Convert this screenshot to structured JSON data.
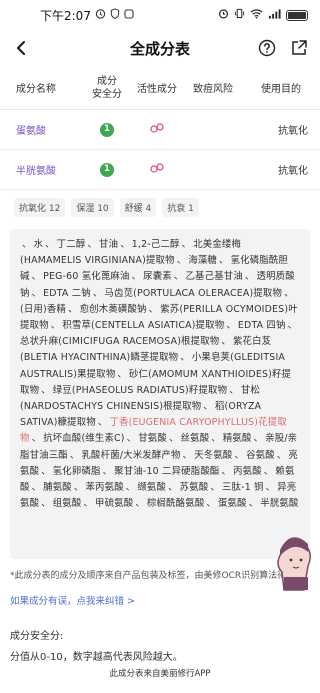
{
  "status": {
    "time": "下午2:07",
    "battery": "100"
  },
  "nav": {
    "title": "全成分表"
  },
  "table": {
    "headers": {
      "name": "成分名称",
      "safety_line1": "成分",
      "safety_line2": "安全分",
      "active": "活性成分",
      "acne": "致痘风险",
      "use": "使用目的"
    },
    "rows": [
      {
        "name": "蛋氨酸",
        "safety": "1",
        "use": "抗氧化"
      },
      {
        "name": "半胱氨酸",
        "safety": "1",
        "use": "抗氧化"
      }
    ]
  },
  "tags": [
    "抗氧化 12",
    "保湿 10",
    "舒缓 4",
    "抗衰 1"
  ],
  "ingredients": [
    "水",
    "丁二醇",
    "甘油",
    "1,2-己二醇",
    "北美金缕梅(HAMAMELIS VIRGINIANA)提取物",
    "海藻糖",
    "氢化磷脂酰胆碱",
    "PEG-60 氢化蓖麻油",
    "尿囊素",
    "乙基己基甘油",
    "透明质酸钠",
    "EDTA 二钠",
    "马齿苋(PORTULACA OLERACEA)提取物",
    "(日用)香精",
    "愈创木薁磺酸钠",
    "紫苏(PERILLA OCYMOIDES)叶提取物",
    "积雪草(CENTELLA ASIATICA)提取物",
    "EDTA 四钠",
    "总状升麻(CIMICIFUGA RACEMOSA)根提取物",
    "紫花白芨(BLETIA HYACINTHINA)鳞茎提取物",
    "小果皂荚(GLEDITSIA AUSTRALIS)果提取物",
    "砂仁(AMOMUM XANTHIOIDES)籽提取物",
    "绿豆(PHASEOLUS RADIATUS)籽提取物",
    "甘松(NARDOSTACHYS CHINENSIS)根提取物",
    "稻(ORYZA SATIVA)糠提取物",
    "丁香(EUGENIA CARYOPHYLLUS)花提取物",
    "抗坏血酸(维生素C)",
    "甘氨酸",
    "丝氨酸",
    "精氨酸",
    "亲股/亲脂甘油三酯",
    "乳酸杆菌/大米发酵产物",
    "天冬氨酸",
    "谷氨酸",
    "亮氨酸",
    "氢化卵磷脂",
    "聚甘油-10 二异硬脂酸酯",
    "丙氨酸",
    "赖氨酸",
    "脯氨酸",
    "苯丙氨酸",
    "缬氨酸",
    "苏氨酸",
    "三肽-1 铜",
    "异亮氨酸",
    "组氨酸",
    "甲硫氨酸",
    "棕榈酰酪氨酸",
    "蛋氨酸",
    "半胱氨酸"
  ],
  "note": "*此成分表的成分及顺序来自产品包装及标签，由美修OCR识别算法得出。",
  "link_text": "如果成分有误，点我来纠错 >",
  "safety_title": "成分安全分:",
  "safety_desc": "分值从0-10，数字越高代表风险越大。",
  "footer": "此成分表来自美丽修行APP",
  "colors": {
    "accent_purple": "#7a54c9",
    "safe_green": "#3ea84f",
    "active_pink": "#e0457b",
    "link_blue": "#4a6fd1"
  }
}
